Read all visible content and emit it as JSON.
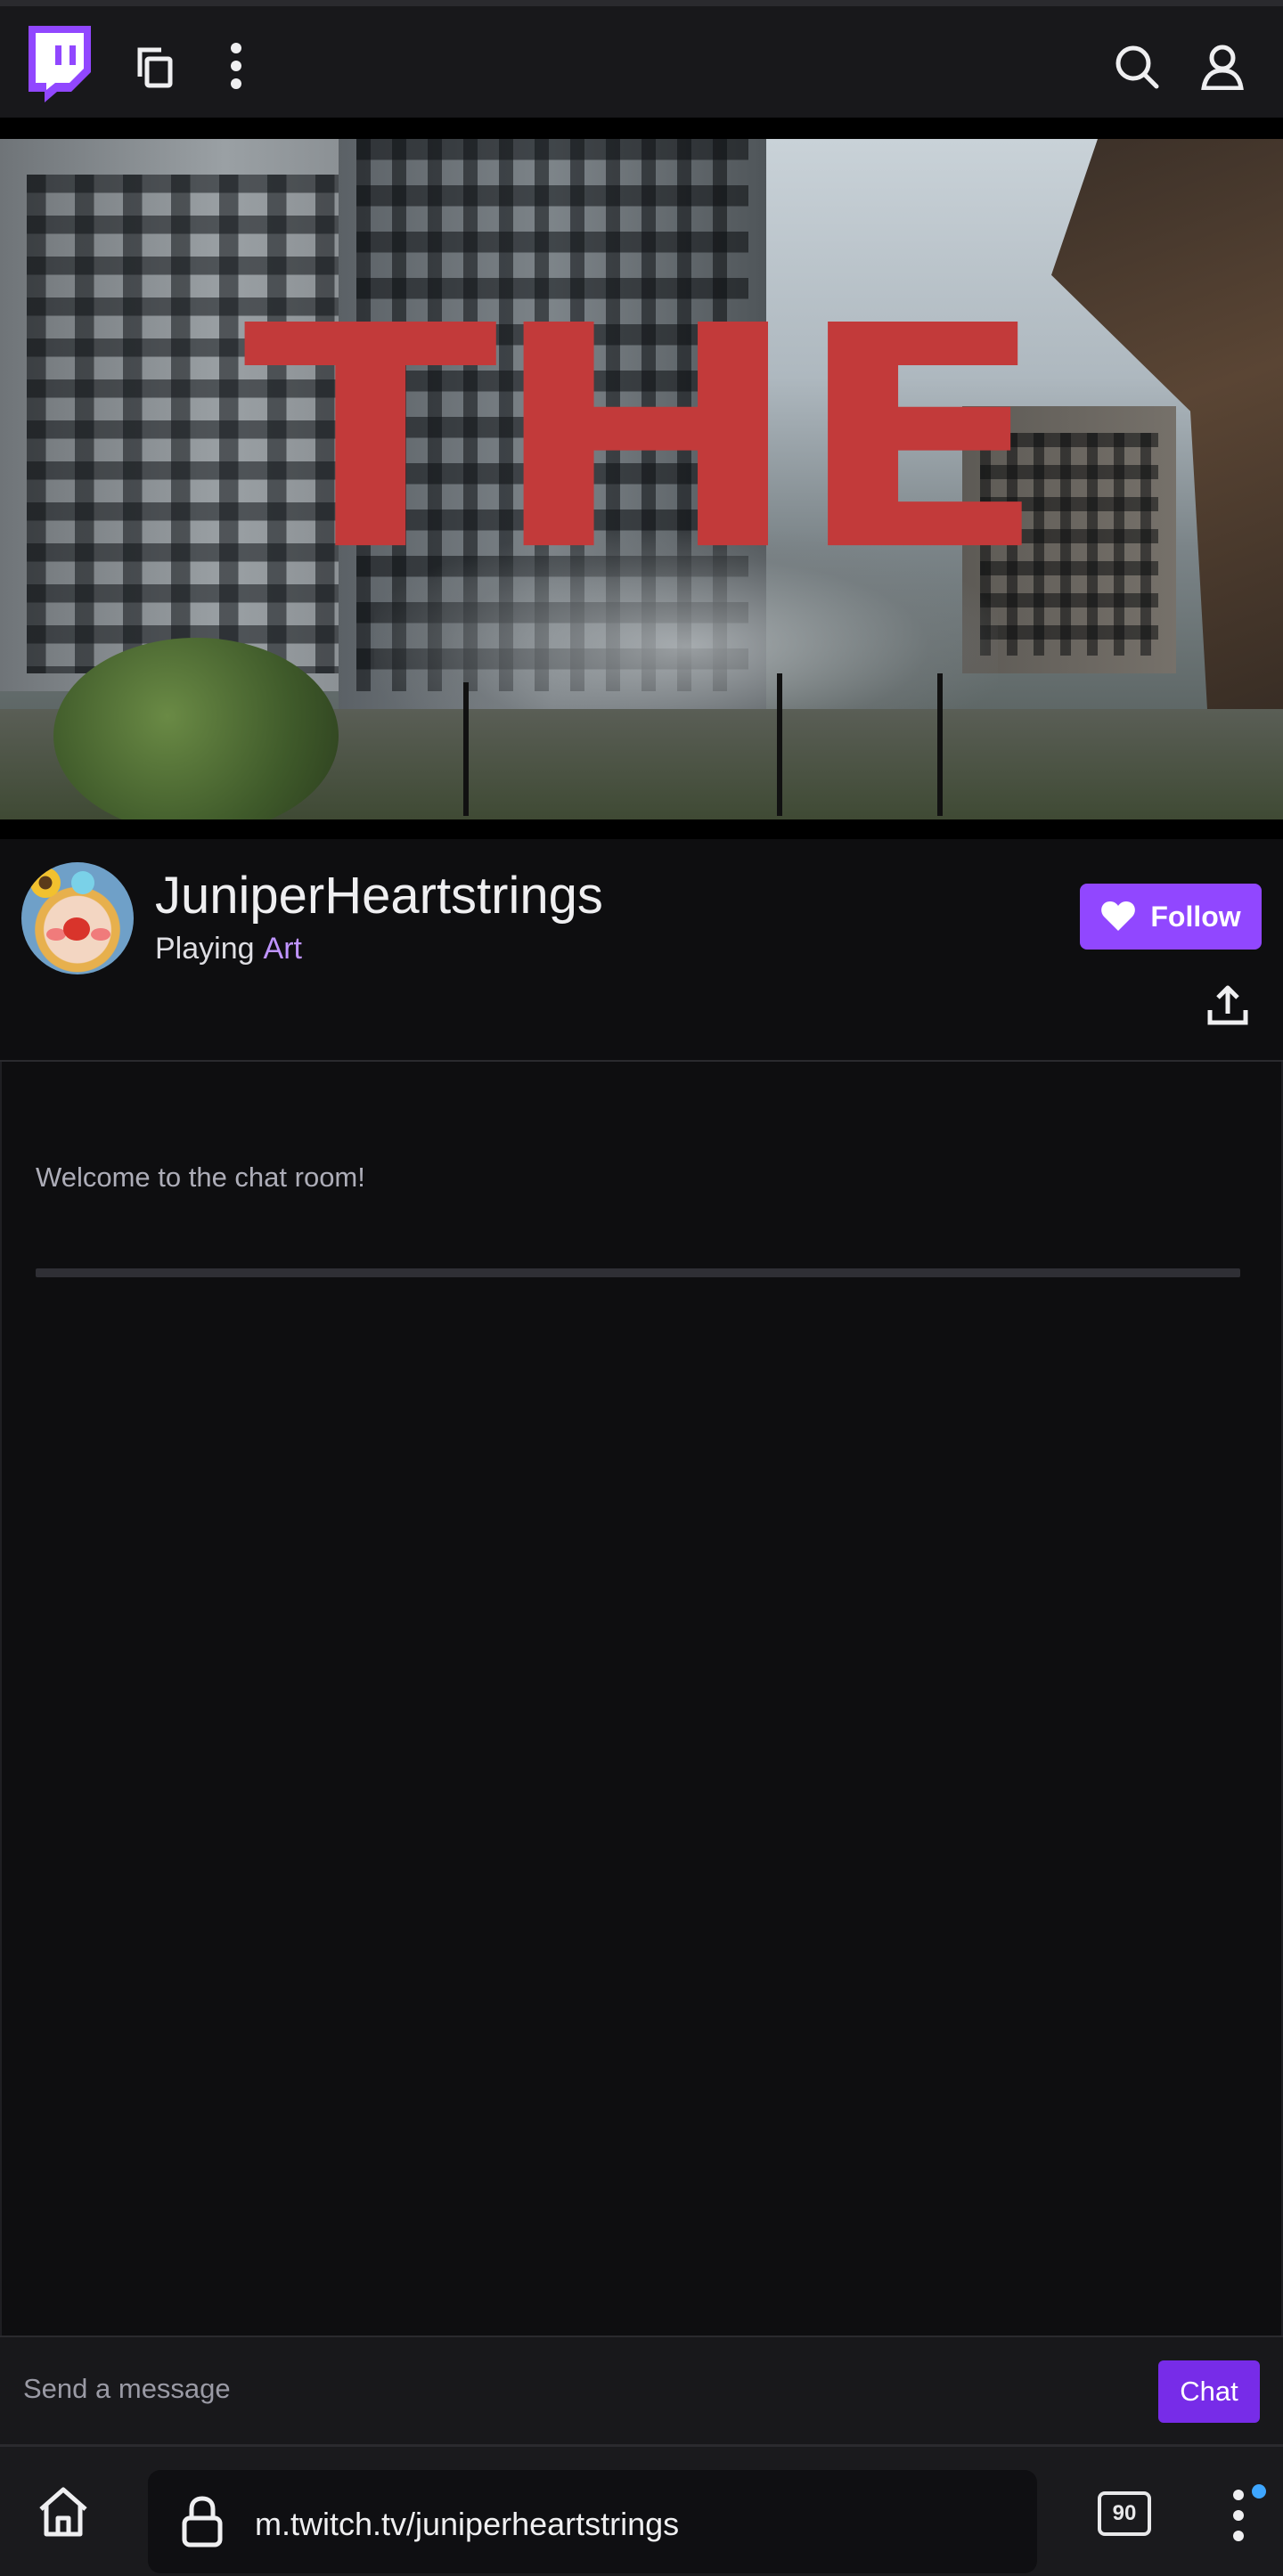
{
  "topbar": {
    "logo_icon": "twitch-logo-icon",
    "copy_icon": "copy-icon",
    "more_icon": "more-vertical-icon",
    "search_icon": "search-icon",
    "user_icon": "user-icon"
  },
  "video": {
    "overlay_text": "THE"
  },
  "channel": {
    "name": "JuniperHeartstrings",
    "playing_prefix": "Playing",
    "game": "Art",
    "follow_label": "Follow",
    "share_icon": "share-upload-icon"
  },
  "chat": {
    "welcome": "Welcome to the chat room!",
    "input_placeholder": "Send a message",
    "send_label": "Chat"
  },
  "browser": {
    "url": "m.twitch.tv/juniperheartstrings",
    "tab_count": "90"
  },
  "colors": {
    "accent": "#9147ff",
    "chat_button": "#772ce8",
    "game_link": "#bf94ff",
    "background": "#0e0e10"
  }
}
